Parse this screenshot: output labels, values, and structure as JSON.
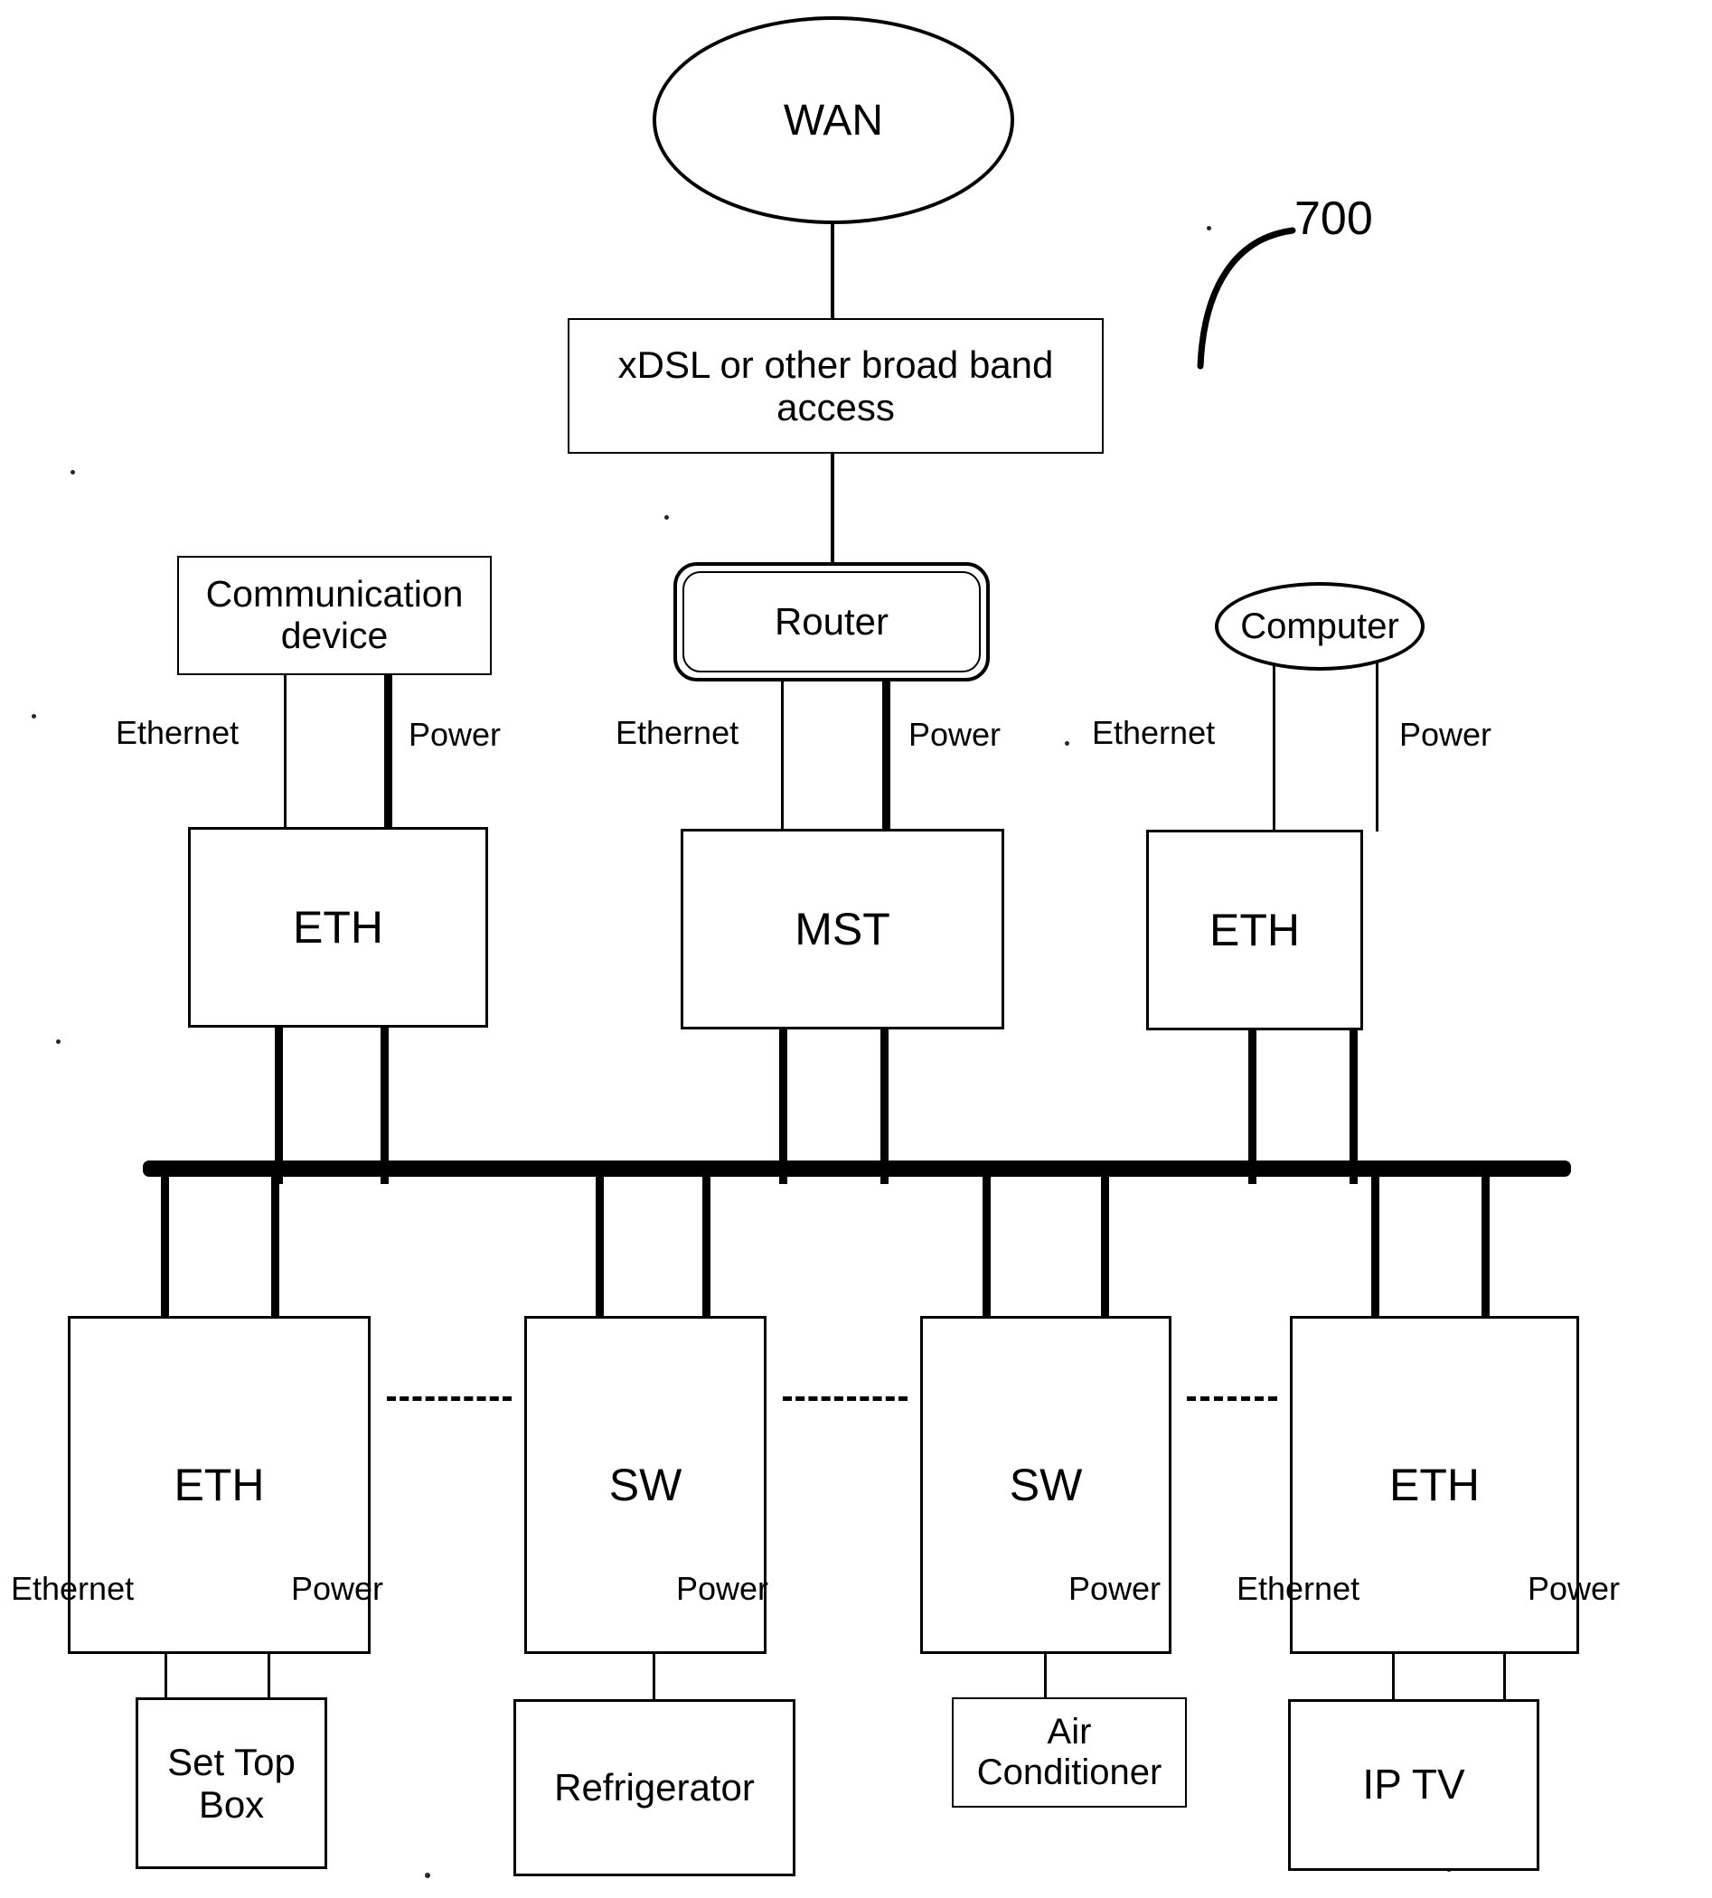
{
  "figure": {
    "reference_number": "700",
    "nodes": {
      "wan": "WAN",
      "broadband": "xDSL or other broad band access",
      "comm_device": "Communication device",
      "router": "Router",
      "computer": "Computer",
      "eth_left_top": "ETH",
      "mst": "MST",
      "eth_right_top": "ETH",
      "eth_left_bottom": "ETH",
      "sw_1": "SW",
      "sw_2": "SW",
      "eth_right_bottom": "ETH",
      "set_top_box": "Set Top Box",
      "refrigerator": "Refrigerator",
      "air_conditioner": "Air Conditioner",
      "ip_tv": "IP TV"
    },
    "link_labels": {
      "comm_ethernet": "Ethernet",
      "comm_power": "Power",
      "router_ethernet": "Ethernet",
      "router_power": "Power",
      "computer_ethernet": "Ethernet",
      "computer_power": "Power",
      "stb_ethernet": "Ethernet",
      "stb_power": "Power",
      "fridge_power": "Power",
      "ac_power": "Power",
      "iptv_ethernet": "Ethernet",
      "iptv_power": "Power"
    },
    "colors": {
      "line": "#000000",
      "background": "#ffffff"
    }
  }
}
